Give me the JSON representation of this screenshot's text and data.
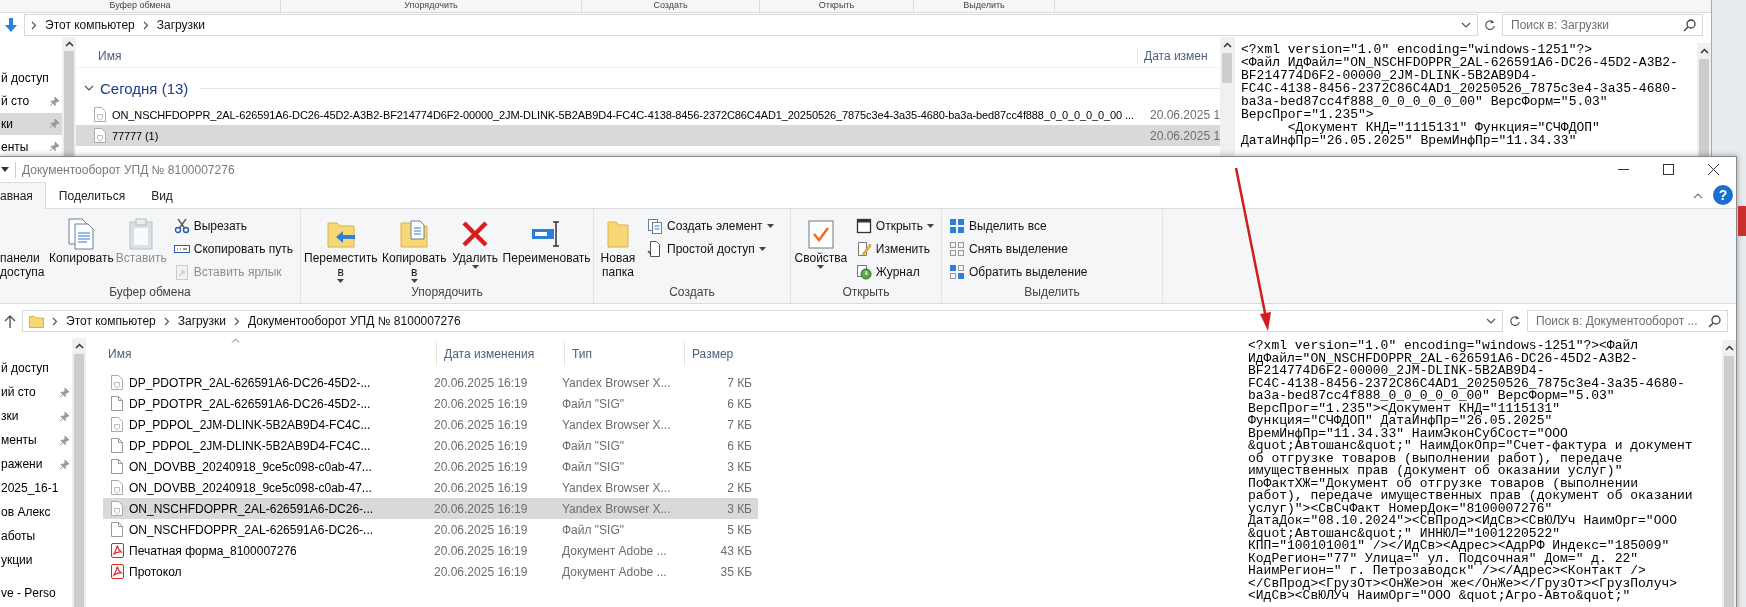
{
  "background_window": {
    "ribbon_group_labels": [
      "Буфер обмена",
      "Упорядочить",
      "Создать",
      "Открыть",
      "Выделить"
    ],
    "address": {
      "crumbs": [
        "Этот компьютер",
        "Загрузки"
      ]
    },
    "search": {
      "placeholder": "Поиск в: Загрузки"
    },
    "nav_items": [
      {
        "label": "й доступ",
        "pinned": false,
        "selected": false
      },
      {
        "label": "й сто",
        "pinned": true,
        "selected": false
      },
      {
        "label": "ки",
        "pinned": true,
        "selected": true
      },
      {
        "label": "енты",
        "pinned": true,
        "selected": false
      }
    ],
    "columns": [
      "Имя",
      "Дата измен"
    ],
    "group": {
      "label": "Сегодня (13)",
      "expanded": true
    },
    "rows": [
      {
        "name": "ON_NSCHFDOPPR_2AL-626591A6-DC26-45D2-A3B2-BF214774D6F2-00000_2JM-DLINK-5B2AB9D4-FC4C-4138-8456-2372C86C4AD1_20250526_7875c3e4-3a35-4680-ba3a-bed87cc4f888_0_0_0_0_0_00 ...",
        "date": "20.06.2025 1",
        "selected": false
      },
      {
        "name": "77777 (1)",
        "date": "20.06.2025 1",
        "selected": true
      }
    ],
    "preview_lines": [
      "<?xml version=\"1.0\" encoding=\"windows-1251\"?>",
      "<Файл ИдФайл=\"ON_NSCHFDOPPR_2AL-626591A6-DC26-45D2-A3B2-",
      "BF214774D6F2-00000_2JM-DLINK-5B2AB9D4-",
      "FC4C-4138-8456-2372C86C4AD1_20250526_7875c3e4-3a35-4680-",
      "ba3a-bed87cc4f888_0_0_0_0_0_00\" ВерсФорм=\"5.03\"",
      "ВерсПрог=\"1.235\">",
      "      <Документ КНД=\"1115131\" Функция=\"СЧФДОП\"",
      "ДатаИнфПр=\"26.05.2025\" ВремИнфПр=\"11.34.33\""
    ]
  },
  "window": {
    "title": "Документооборот УПД № 8100007276",
    "tabs": [
      {
        "label": "авная",
        "selected": true
      },
      {
        "label": "Поделиться",
        "selected": false
      },
      {
        "label": "Вид",
        "selected": false
      }
    ],
    "help": "?",
    "ribbon": [
      {
        "label": "Буфер обмена",
        "items": [
          {
            "kind": "large",
            "lines": [
              "панели",
              "доступа"
            ],
            "disabled": false,
            "dropdown": false
          },
          {
            "kind": "large",
            "lines": [
              "Копировать"
            ],
            "disabled": false,
            "dropdown": false
          },
          {
            "kind": "large",
            "lines": [
              "Вставить"
            ],
            "disabled": true,
            "dropdown": false
          },
          {
            "kind": "small",
            "lines": [
              "Вырезать"
            ],
            "disabled": false,
            "dropdown": false
          },
          {
            "kind": "small",
            "lines": [
              "Скопировать путь"
            ],
            "disabled": false,
            "dropdown": false
          },
          {
            "kind": "small",
            "lines": [
              "Вставить ярлык"
            ],
            "disabled": true,
            "dropdown": false
          }
        ]
      },
      {
        "label": "Упорядочить",
        "items": [
          {
            "kind": "large",
            "lines": [
              "Переместить",
              "в"
            ],
            "disabled": false,
            "dropdown": true
          },
          {
            "kind": "large",
            "lines": [
              "Копировать",
              "в"
            ],
            "disabled": false,
            "dropdown": true
          },
          {
            "kind": "large",
            "lines": [
              "Удалить"
            ],
            "disabled": false,
            "dropdown": true
          },
          {
            "kind": "large",
            "lines": [
              "Переименовать"
            ],
            "disabled": false,
            "dropdown": false
          }
        ]
      },
      {
        "label": "Создать",
        "items": [
          {
            "kind": "large",
            "lines": [
              "Новая",
              "папка"
            ],
            "disabled": false,
            "dropdown": false
          },
          {
            "kind": "small",
            "lines": [
              "Создать элемент"
            ],
            "disabled": false,
            "dropdown": true
          },
          {
            "kind": "small",
            "lines": [
              "Простой доступ"
            ],
            "disabled": false,
            "dropdown": true
          }
        ]
      },
      {
        "label": "Открыть",
        "items": [
          {
            "kind": "large",
            "lines": [
              "Свойства"
            ],
            "disabled": false,
            "dropdown": true
          },
          {
            "kind": "small",
            "lines": [
              "Открыть"
            ],
            "disabled": false,
            "dropdown": true
          },
          {
            "kind": "small",
            "lines": [
              "Изменить"
            ],
            "disabled": false,
            "dropdown": false
          },
          {
            "kind": "small",
            "lines": [
              "Журнал"
            ],
            "disabled": false,
            "dropdown": false
          }
        ]
      },
      {
        "label": "Выделить",
        "items": [
          {
            "kind": "small",
            "lines": [
              "Выделить все"
            ],
            "disabled": false,
            "dropdown": false
          },
          {
            "kind": "small",
            "lines": [
              "Снять выделение"
            ],
            "disabled": false,
            "dropdown": false
          },
          {
            "kind": "small",
            "lines": [
              "Обратить выделение"
            ],
            "disabled": false,
            "dropdown": false
          }
        ]
      }
    ],
    "address": {
      "crumbs": [
        "Этот компьютер",
        "Загрузки",
        "Документооборот УПД № 8100007276"
      ]
    },
    "search": {
      "placeholder": "Поиск в: Документооборот ..."
    },
    "nav_items": [
      {
        "label": "й доступ",
        "pinned": false
      },
      {
        "label": "ий сто",
        "pinned": true
      },
      {
        "label": "зки",
        "pinned": true
      },
      {
        "label": "менты",
        "pinned": true
      },
      {
        "label": "ражени",
        "pinned": true
      },
      {
        "label": "2025_16-1",
        "pinned": false
      },
      {
        "label": "ов Алекс",
        "pinned": false
      },
      {
        "label": "аботы",
        "pinned": false
      },
      {
        "label": "укции",
        "pinned": false
      },
      {
        "label": "ve - Perso",
        "pinned": false
      }
    ],
    "columns": [
      "Имя",
      "Дата изменения",
      "Тип",
      "Размер"
    ],
    "files": [
      {
        "kind": "xml",
        "name": "DP_PDOTPR_2AL-626591A6-DC26-45D2-...",
        "date": "20.06.2025 16:19",
        "type": "Yandex Browser X...",
        "size": "7 КБ",
        "selected": false
      },
      {
        "kind": "sig",
        "name": "DP_PDOTPR_2AL-626591A6-DC26-45D2-...",
        "date": "20.06.2025 16:19",
        "type": "Файл \"SIG\"",
        "size": "6 КБ",
        "selected": false
      },
      {
        "kind": "xml",
        "name": "DP_PDPOL_2JM-DLINK-5B2AB9D4-FC4C...",
        "date": "20.06.2025 16:19",
        "type": "Yandex Browser X...",
        "size": "7 КБ",
        "selected": false
      },
      {
        "kind": "sig",
        "name": "DP_PDPOL_2JM-DLINK-5B2AB9D4-FC4C...",
        "date": "20.06.2025 16:19",
        "type": "Файл \"SIG\"",
        "size": "6 КБ",
        "selected": false
      },
      {
        "kind": "sig",
        "name": "ON_DOVBB_20240918_9ce5c098-c0ab-47...",
        "date": "20.06.2025 16:19",
        "type": "Файл \"SIG\"",
        "size": "3 КБ",
        "selected": false
      },
      {
        "kind": "xml",
        "name": "ON_DOVBB_20240918_9ce5c098-c0ab-47...",
        "date": "20.06.2025 16:19",
        "type": "Yandex Browser X...",
        "size": "2 КБ",
        "selected": false
      },
      {
        "kind": "xml",
        "name": "ON_NSCHFDOPPR_2AL-626591A6-DC26-...",
        "date": "20.06.2025 16:19",
        "type": "Yandex Browser X...",
        "size": "3 КБ",
        "selected": true
      },
      {
        "kind": "sig",
        "name": "ON_NSCHFDOPPR_2AL-626591A6-DC26-...",
        "date": "20.06.2025 16:19",
        "type": "Файл \"SIG\"",
        "size": "5 КБ",
        "selected": false
      },
      {
        "kind": "pdf",
        "name": "Печатная форма_8100007276",
        "date": "20.06.2025 16:19",
        "type": "Документ Adobe ...",
        "size": "43 КБ",
        "selected": false
      },
      {
        "kind": "pdf",
        "name": "Протокол",
        "date": "20.06.2025 16:19",
        "type": "Документ Adobe ...",
        "size": "35 КБ",
        "selected": false
      }
    ],
    "preview_lines": [
      "<?xml version=\"1.0\" encoding=\"windows-1251\"?><Файл",
      "ИдФайл=\"ON_NSCHFDOPPR_2AL-626591A6-DC26-45D2-A3B2-",
      "BF214774D6F2-00000_2JM-DLINK-5B2AB9D4-",
      "FC4C-4138-8456-2372C86C4AD1_20250526_7875c3e4-3a35-4680-",
      "ba3a-bed87cc4f888_0_0_0_0_0_00\" ВерсФорм=\"5.03\"",
      "ВерсПрог=\"1.235\"><Документ КНД=\"1115131\"",
      "Функция=\"СЧФДОП\" ДатаИнфПр=\"26.05.2025\"",
      "ВремИнфПр=\"11.34.33\" НаимЭконСубСост=\"ООО",
      "&quot;Автошанс&quot;\" НаимДокОпр=\"Счет-фактура и документ",
      "об отгрузке товаров (выполнении работ), передаче",
      "имущественных прав (документ об оказании услуг)\"",
      "ПоФактХЖ=\"Документ об отгрузке товаров (выполнении",
      "работ), передаче имущественных прав (документ об оказании",
      "услуг)\"><СвСчФакт НомерДок=\"8100007276\"",
      "ДатаДок=\"08.10.2024\"><СвПрод><ИдСв><СвЮЛУч НаимОрг=\"ООО",
      "&quot;Автошанс&quot;\" ИННЮЛ=\"1001220522\"",
      "КПП=\"100101001\" /></ИдСв><Адрес><АдрРФ Индекс=\"185009\"",
      "КодРегион=\"77\" Улица=\" ул. Подсочная\" Дом=\" д. 22\"",
      "НаимРегион=\" г. Петрозаводск\" /></Адрес><Контакт />",
      "</СвПрод><ГрузОт><ОнЖе>он же</ОнЖе></ГрузОт><ГрузПолуч>",
      "<ИдСв><СвЮЛУч НаимОрг=\"ООО &quot;Агро-Авто&quot;\""
    ]
  }
}
